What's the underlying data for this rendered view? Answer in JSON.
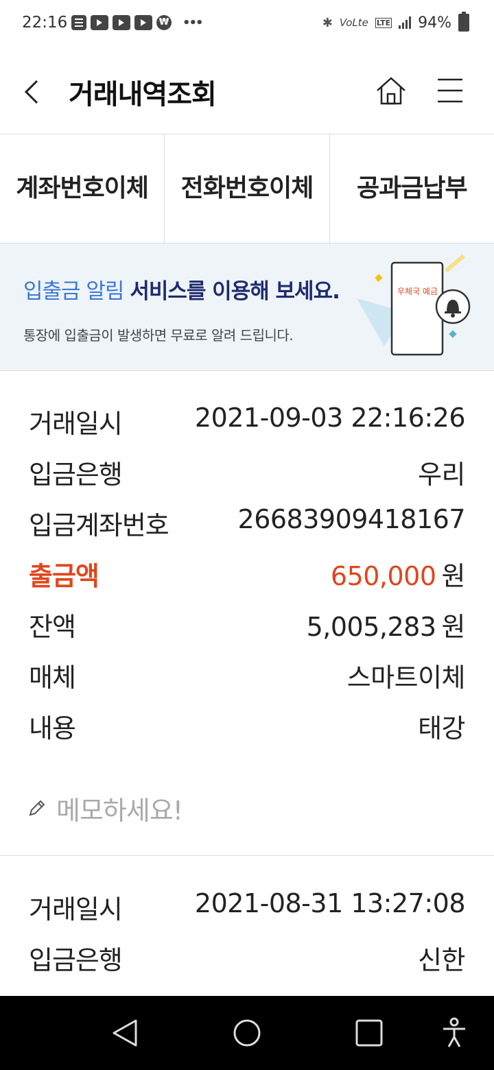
{
  "status_bar": {
    "time": "22:16",
    "battery": "94%"
  },
  "header": {
    "title": "거래내역조회"
  },
  "quick_tabs": [
    {
      "label": "계좌번호이체"
    },
    {
      "label": "전화번호이체"
    },
    {
      "label": "공과금납부"
    }
  ],
  "banner": {
    "headline_light": "입출금 알림 ",
    "headline_bold": "서비스를 이용해 보세요.",
    "subtext": "통장에 입출금이 발생하면 무료로 알려 드립니다.",
    "phone_text": "우체국 예금"
  },
  "transactions": [
    {
      "date_label": "거래일시",
      "date": "2021-09-03 22:16:26",
      "bank_label": "입금은행",
      "bank": "우리",
      "account_label": "입금계좌번호",
      "account": "26683909418167",
      "amount_label": "출금액",
      "amount": "650,000",
      "amount_unit": "원",
      "balance_label": "잔액",
      "balance": "5,005,283",
      "balance_unit": "원",
      "medium_label": "매체",
      "medium": "스마트이체",
      "content_label": "내용",
      "content": "태강"
    },
    {
      "date_label": "거래일시",
      "date": "2021-08-31 13:27:08",
      "bank_label": "입금은행",
      "bank": "신한"
    }
  ],
  "memo": {
    "placeholder": "메모하세요!"
  },
  "icons": [
    "back-icon",
    "home-icon",
    "menu-icon",
    "pencil-icon",
    "bell-icon",
    "nav-back-icon",
    "nav-home-icon",
    "nav-recents-icon",
    "accessibility-icon"
  ],
  "colors": {
    "highlight": "#e0461c",
    "banner_bg": "#eef4f8",
    "headline_blue": "#3c78d8",
    "headline_navy": "#1f2b6f"
  }
}
